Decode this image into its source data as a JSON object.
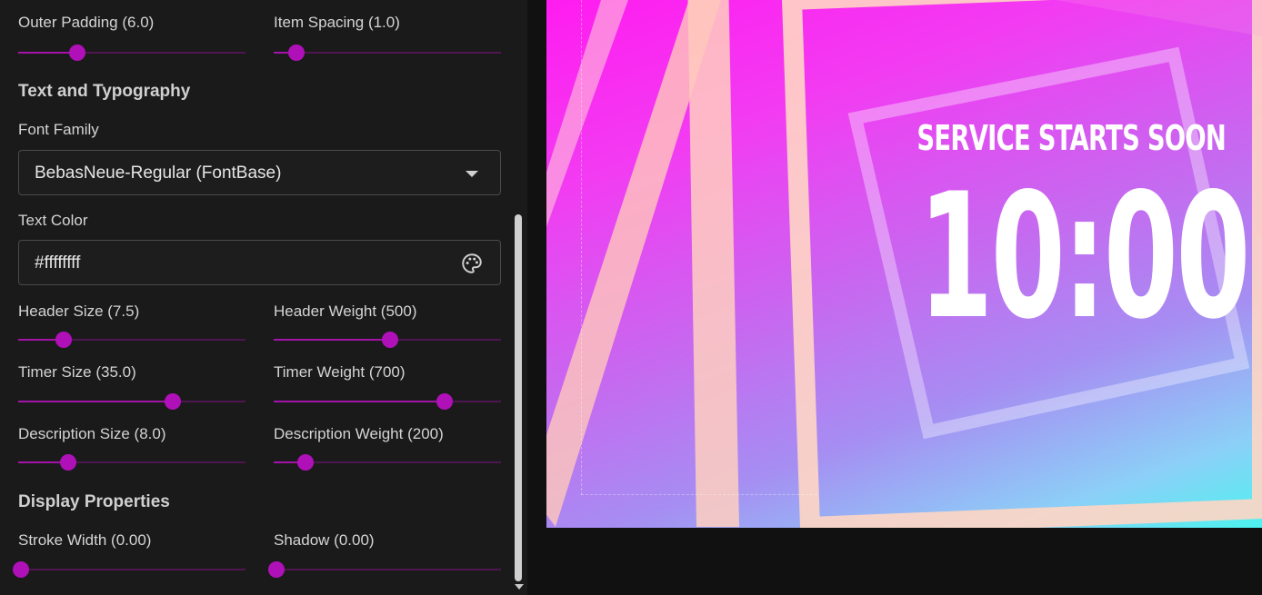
{
  "panel": {
    "outer_padding": {
      "label": "Outer Padding (6.0)",
      "value": 0.26
    },
    "item_spacing": {
      "label": "Item Spacing (1.0)",
      "value": 0.1
    },
    "section_text": "Text and Typography",
    "font_family": {
      "label": "Font Family",
      "value": "BebasNeue-Regular (FontBase)"
    },
    "text_color": {
      "label": "Text Color",
      "value": "#ffffffff"
    },
    "header_size": {
      "label": "Header Size (7.5)",
      "value": 0.2
    },
    "header_weight": {
      "label": "Header Weight (500)",
      "value": 0.51
    },
    "timer_size": {
      "label": "Timer Size (35.0)",
      "value": 0.68
    },
    "timer_weight": {
      "label": "Timer Weight (700)",
      "value": 0.75
    },
    "description_size": {
      "label": "Description Size (8.0)",
      "value": 0.22
    },
    "description_weight": {
      "label": "Description Weight (200)",
      "value": 0.14
    },
    "section_display": "Display Properties",
    "stroke_width": {
      "label": "Stroke Width (0.00)",
      "value": 0.01
    },
    "shadow": {
      "label": "Shadow (0.00)",
      "value": 0.01
    }
  },
  "preview": {
    "header": "SERVICE STARTS SOON",
    "timer": "10:00"
  },
  "colors": {
    "accent": "#b010b8",
    "track": "#4d1650",
    "panel_bg": "#1a1a1a"
  },
  "icons": {
    "dropdown": "chevron-down-icon",
    "color_picker": "palette-icon"
  }
}
